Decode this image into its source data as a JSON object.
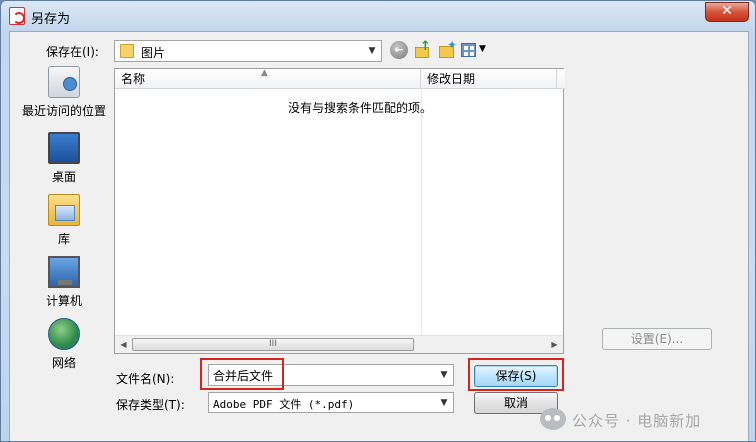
{
  "window": {
    "title": "另存为",
    "close_glyph": "✕"
  },
  "toolbar": {
    "savein_label": "保存在(I):",
    "location": "图片",
    "icons": [
      "back-icon",
      "up-folder-icon",
      "new-folder-icon",
      "views-menu-icon"
    ]
  },
  "places": [
    {
      "label": "最近访问的位置",
      "icon": "recent-places-icon"
    },
    {
      "label": "桌面",
      "icon": "desktop-icon"
    },
    {
      "label": "库",
      "icon": "library-icon"
    },
    {
      "label": "计算机",
      "icon": "computer-icon"
    },
    {
      "label": "网络",
      "icon": "network-icon"
    }
  ],
  "filelist": {
    "columns": [
      "名称",
      "修改日期"
    ],
    "empty_message": "没有与搜索条件匹配的项。",
    "scroll_thumb_glyph": "III"
  },
  "settings_label": "设置(E)...",
  "form": {
    "filename_label": "文件名(N):",
    "filename_value": "合并后文件",
    "filetype_label": "保存类型(T):",
    "filetype_value": "Adobe PDF 文件 (*.pdf)"
  },
  "buttons": {
    "save": "保存(S)",
    "cancel": "取消"
  },
  "watermark": "公众号 · 电脑新加"
}
